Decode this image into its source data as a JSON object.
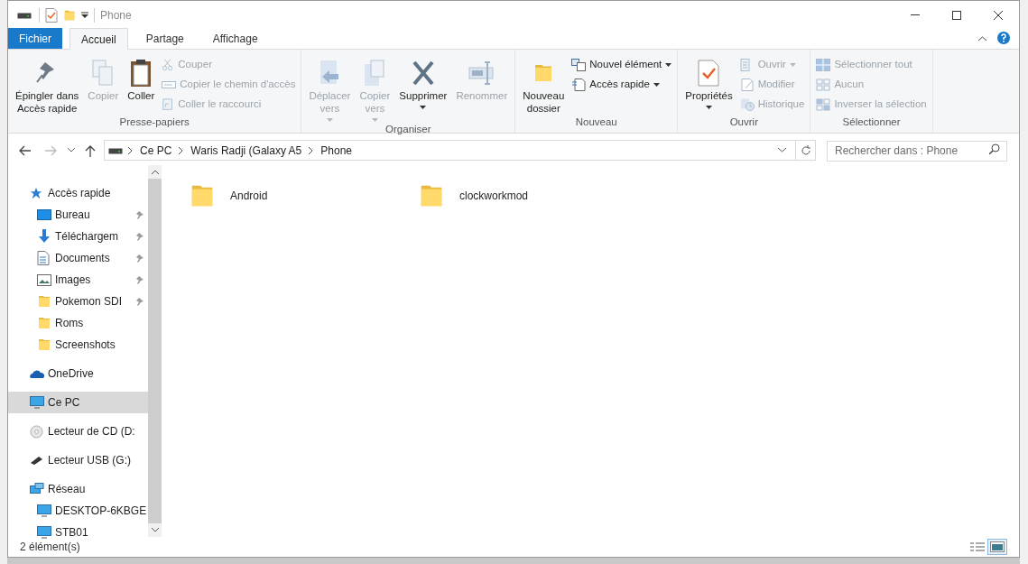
{
  "window": {
    "title": "Phone"
  },
  "ribbon_tabs": [
    {
      "label": "Fichier",
      "kind": "file",
      "selected": false
    },
    {
      "label": "Accueil",
      "kind": "tab",
      "selected": true
    },
    {
      "label": "Partage",
      "kind": "tab",
      "selected": false
    },
    {
      "label": "Affichage",
      "kind": "tab",
      "selected": false
    }
  ],
  "ribbon_groups": [
    {
      "label": "Presse-papiers",
      "items": [
        {
          "kind": "large",
          "label": "Épingler dans\nAccès rapide",
          "disabled": false,
          "dropdown": false
        },
        {
          "kind": "large",
          "label": "Copier",
          "disabled": true,
          "dropdown": false
        },
        {
          "kind": "large",
          "label": "Coller",
          "disabled": false,
          "dropdown": false
        },
        {
          "kind": "small",
          "label": "Couper",
          "disabled": true,
          "dropdown": false
        },
        {
          "kind": "small",
          "label": "Copier le chemin d'accès",
          "disabled": true,
          "dropdown": false
        },
        {
          "kind": "small",
          "label": "Coller le raccourci",
          "disabled": true,
          "dropdown": false
        }
      ]
    },
    {
      "label": "Organiser",
      "items": [
        {
          "kind": "large",
          "label": "Déplacer\nvers",
          "disabled": true,
          "dropdown": true
        },
        {
          "kind": "large",
          "label": "Copier\nvers",
          "disabled": true,
          "dropdown": true
        },
        {
          "kind": "large",
          "label": "Supprimer",
          "disabled": false,
          "dropdown": true
        },
        {
          "kind": "large",
          "label": "Renommer",
          "disabled": true,
          "dropdown": false
        }
      ]
    },
    {
      "label": "Nouveau",
      "items": [
        {
          "kind": "large",
          "label": "Nouveau\ndossier",
          "disabled": false,
          "dropdown": false
        },
        {
          "kind": "small",
          "label": "Nouvel élément",
          "disabled": false,
          "dropdown": true
        },
        {
          "kind": "small",
          "label": "Accès rapide",
          "disabled": false,
          "dropdown": true
        }
      ]
    },
    {
      "label": "Ouvrir",
      "items": [
        {
          "kind": "large",
          "label": "Propriétés",
          "disabled": false,
          "dropdown": true
        },
        {
          "kind": "small",
          "label": "Ouvrir",
          "disabled": true,
          "dropdown": true
        },
        {
          "kind": "small",
          "label": "Modifier",
          "disabled": true,
          "dropdown": false
        },
        {
          "kind": "small",
          "label": "Historique",
          "disabled": true,
          "dropdown": false
        }
      ]
    },
    {
      "label": "Sélectionner",
      "items": [
        {
          "kind": "small",
          "label": "Sélectionner tout",
          "disabled": true,
          "dropdown": false
        },
        {
          "kind": "small",
          "label": "Aucun",
          "disabled": true,
          "dropdown": false
        },
        {
          "kind": "small",
          "label": "Inverser la sélection",
          "disabled": true,
          "dropdown": false
        }
      ]
    }
  ],
  "address_bar": {
    "breadcrumbs": [
      "Ce PC",
      "Waris Radji (Galaxy A5",
      "Phone"
    ]
  },
  "search": {
    "placeholder": "Rechercher dans : Phone"
  },
  "sidebar": [
    {
      "label": "Accès rapide",
      "selected": false,
      "children": [
        {
          "label": "Bureau",
          "pinned": true,
          "selected": false
        },
        {
          "label": "Téléchargem",
          "pinned": true,
          "selected": false
        },
        {
          "label": "Documents",
          "pinned": true,
          "selected": false
        },
        {
          "label": "Images",
          "pinned": true,
          "selected": false
        },
        {
          "label": "Pokemon SDI",
          "pinned": true,
          "selected": false
        },
        {
          "label": "Roms",
          "pinned": false,
          "selected": false
        },
        {
          "label": "Screenshots",
          "pinned": false,
          "selected": false
        }
      ]
    },
    {
      "label": "OneDrive",
      "selected": false
    },
    {
      "label": "Ce PC",
      "selected": true
    },
    {
      "label": "Lecteur de CD (D:",
      "selected": false
    },
    {
      "label": "Lecteur USB (G:)",
      "selected": false
    },
    {
      "label": "Réseau",
      "selected": false,
      "children": [
        {
          "label": "DESKTOP-6KBGE",
          "pinned": false,
          "selected": false
        },
        {
          "label": "STB01",
          "pinned": false,
          "selected": false
        }
      ]
    }
  ],
  "files": [
    {
      "name": "Android"
    },
    {
      "name": "clockworkmod"
    }
  ],
  "status_bar": {
    "text": "2 élément(s)",
    "views": [
      {
        "kind": "details",
        "selected": false
      },
      {
        "kind": "large_icons",
        "selected": true
      }
    ]
  }
}
